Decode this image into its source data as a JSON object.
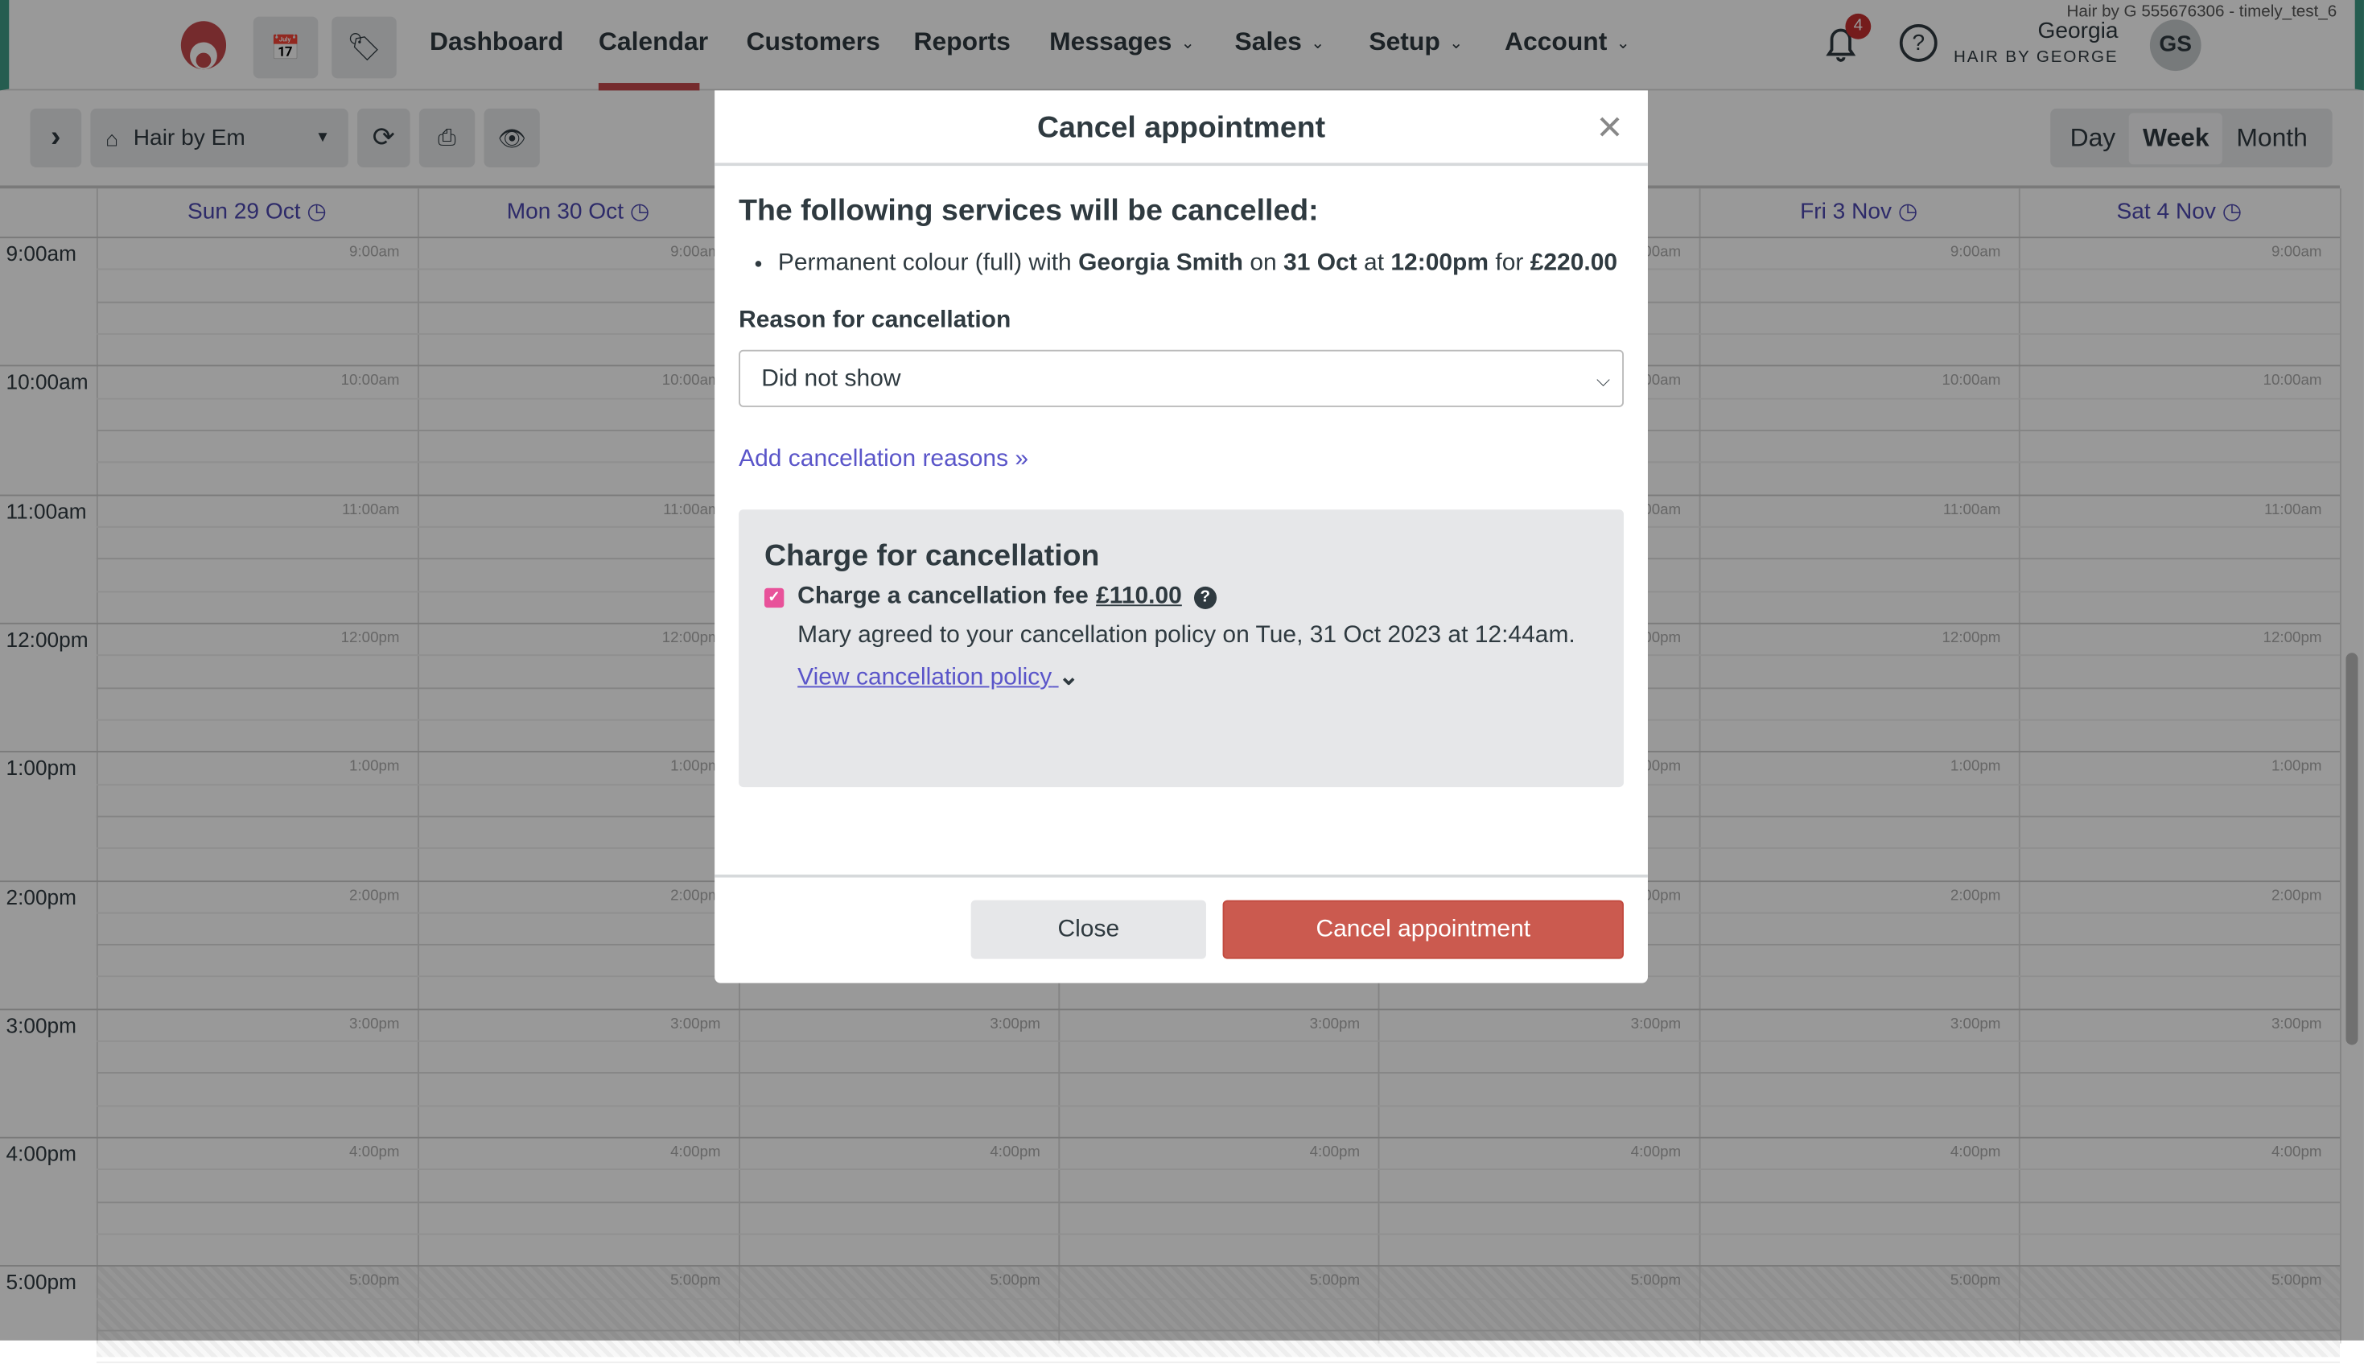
{
  "header": {
    "nav": [
      {
        "label": "Dashboard"
      },
      {
        "label": "Calendar",
        "active": true
      },
      {
        "label": "Customers"
      },
      {
        "label": "Reports"
      },
      {
        "label": "Messages",
        "dropdown": true
      },
      {
        "label": "Sales",
        "dropdown": true
      },
      {
        "label": "Setup",
        "dropdown": true
      },
      {
        "label": "Account",
        "dropdown": true
      }
    ],
    "account_line": "Hair by G 555676306 - timely_test_6",
    "notifications_count": "4",
    "user_name": "Georgia",
    "company": "HAIR BY GEORGE",
    "avatar_initials": "GS",
    "accent": "#c4484b"
  },
  "toolbar": {
    "location": "Hair by Em",
    "views": [
      "Day",
      "Week",
      "Month"
    ],
    "selected_view": "Week"
  },
  "calendar": {
    "days": [
      "Sun 29 Oct",
      "Mon 30 Oct",
      "",
      "",
      "",
      "Fri 3 Nov",
      "Sat 4 Nov"
    ],
    "hours": [
      "9:00am",
      "10:00am",
      "11:00am",
      "12:00pm",
      "1:00pm",
      "2:00pm",
      "3:00pm",
      "4:00pm",
      "5:00pm"
    ]
  },
  "modal": {
    "title": "Cancel appointment",
    "heading": "The following services will be cancelled:",
    "service": {
      "name": "Permanent colour (full)",
      "with": "with",
      "customer": "Georgia Smith",
      "on": "on",
      "date": "31 Oct",
      "at": "at",
      "time": "12:00pm",
      "for": "for",
      "price": "£220.00"
    },
    "reason_label": "Reason for cancellation",
    "reason_value": "Did not show",
    "add_reasons_link": "Add cancellation reasons »",
    "charge": {
      "title": "Charge for cancellation",
      "checkbox_label": "Charge a cancellation fee",
      "checked": true,
      "fee": "£110.00",
      "agreement": "Mary agreed to your cancellation policy on Tue, 31 Oct 2023 at 12:44am.",
      "view_policy": "View cancellation policy"
    },
    "close_button": "Close",
    "cancel_button": "Cancel appointment",
    "cancel_color": "#cb5a4f"
  }
}
